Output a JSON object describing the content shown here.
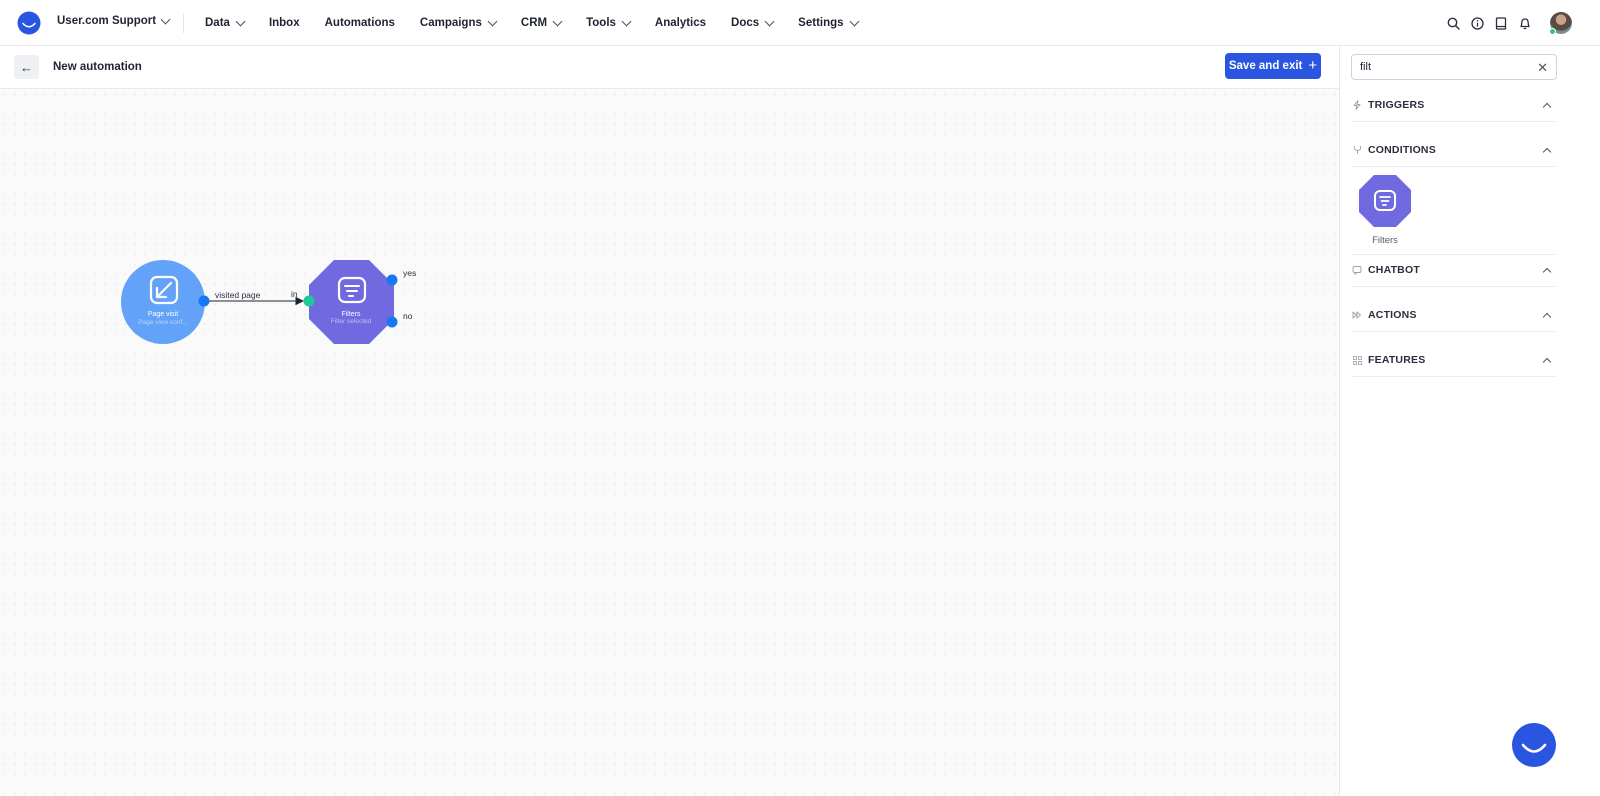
{
  "header": {
    "workspace": "User.com Support",
    "nav": [
      {
        "label": "Data",
        "dropdown": true
      },
      {
        "label": "Inbox",
        "dropdown": false
      },
      {
        "label": "Automations",
        "dropdown": false
      },
      {
        "label": "Campaigns",
        "dropdown": true
      },
      {
        "label": "CRM",
        "dropdown": true
      },
      {
        "label": "Tools",
        "dropdown": true
      },
      {
        "label": "Analytics",
        "dropdown": false
      },
      {
        "label": "Docs",
        "dropdown": true
      },
      {
        "label": "Settings",
        "dropdown": true
      }
    ],
    "icons": [
      "search-icon",
      "info-icon",
      "book-icon",
      "bell-icon"
    ]
  },
  "subbar": {
    "title": "New automation",
    "save_label": "Save and exit"
  },
  "canvas": {
    "nodes": [
      {
        "id": "page-visit",
        "title": "Page visit",
        "subtitle": "Page view conf...",
        "color": "#62a2f8"
      },
      {
        "id": "filters",
        "title": "Filters",
        "subtitle": "Filter selected",
        "color": "#7169e0"
      }
    ],
    "edge": {
      "label": "visited page",
      "input_label": "in"
    },
    "outputs": {
      "yes": "yes",
      "no": "no"
    }
  },
  "panel": {
    "search_value": "filt",
    "sections": [
      {
        "label": "TRIGGERS",
        "icon": "bolt-icon"
      },
      {
        "label": "CONDITIONS",
        "icon": "branch-icon"
      },
      {
        "label": "CHATBOT",
        "icon": "chat-icon"
      },
      {
        "label": "ACTIONS",
        "icon": "fast-forward-icon"
      },
      {
        "label": "FEATURES",
        "icon": "grid-icon"
      }
    ],
    "tile_label": "Filters"
  },
  "colors": {
    "accent": "#2a55e0",
    "trigger_node": "#62a2f8",
    "condition_node": "#7169e0",
    "port": "#1877f2",
    "input_port": "#20c997"
  }
}
